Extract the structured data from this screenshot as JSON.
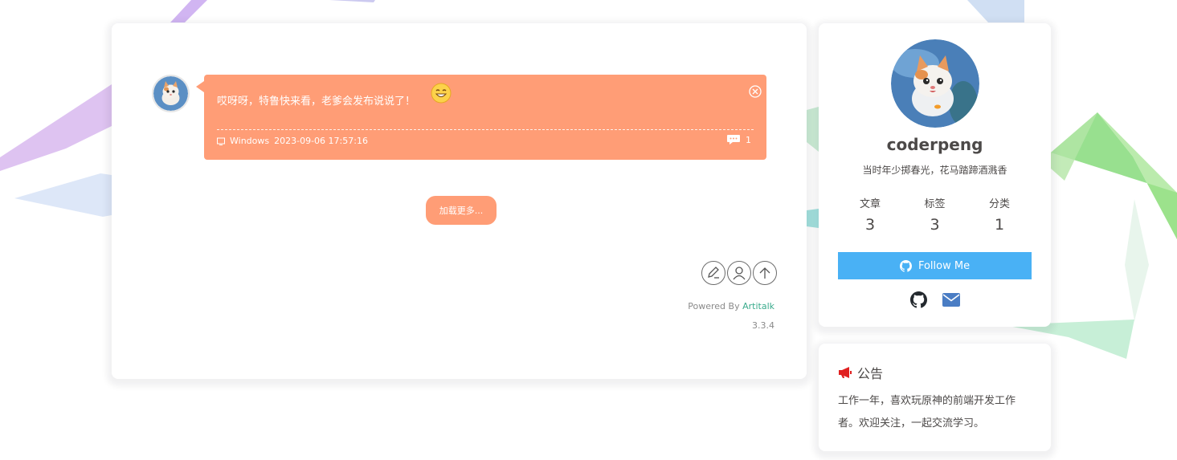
{
  "talk": {
    "content": "哎呀呀，特鲁快来看，老爹会发布说说了！",
    "emoji": "smiling-face-emoji",
    "device": "Windows",
    "datetime": "2023-09-06 17:57:16",
    "comment_count": "1",
    "bubble_color": "#ff9d76"
  },
  "load_more_label": "加载更多...",
  "toolbar": {
    "icons": [
      "edit-icon",
      "user-icon",
      "arrow-up-icon"
    ]
  },
  "footer": {
    "powered_prefix": "Powered By ",
    "powered_link": "Artitalk",
    "version": "3.3.4"
  },
  "profile": {
    "name": "coderpeng",
    "description": "当时年少掷春光，花马踏蹄酒溅香",
    "stats": [
      {
        "label": "文章",
        "value": "3"
      },
      {
        "label": "标签",
        "value": "3"
      },
      {
        "label": "分类",
        "value": "1"
      }
    ],
    "follow_label": "Follow Me",
    "follow_color": "#49b1f5",
    "social": [
      "github-icon",
      "email-icon"
    ]
  },
  "notice": {
    "title": "公告",
    "text": "工作一年，喜欢玩原神的前端开发工作者。欢迎关注，一起交流学习。",
    "icon_color": "#e02020"
  }
}
